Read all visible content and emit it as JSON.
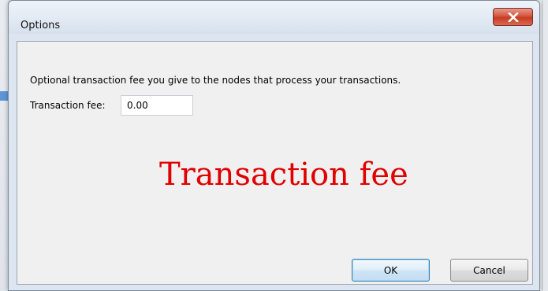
{
  "dialog": {
    "title": "Options",
    "close_icon": "close-x-icon"
  },
  "fee": {
    "description": "Optional transaction fee you give to the nodes that process your transactions.",
    "label": "Transaction fee:",
    "value": "0.00"
  },
  "annotation": {
    "text": "Transaction fee",
    "color": "#e00000"
  },
  "buttons": {
    "ok_label": "OK",
    "cancel_label": "Cancel"
  },
  "colors": {
    "close_button": "#c43a22",
    "window_frame": "#dde6f0",
    "client_area": "#f0f0f0"
  }
}
